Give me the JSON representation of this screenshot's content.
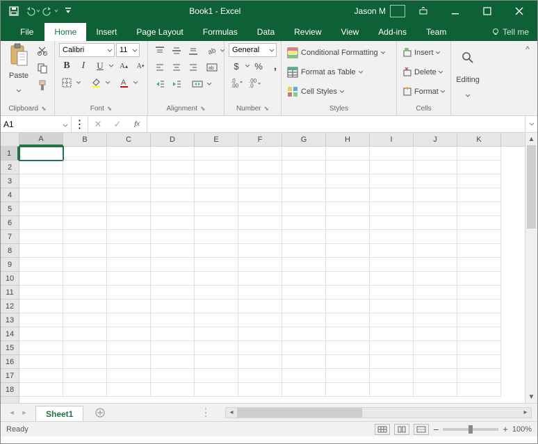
{
  "title": "Book1 - Excel",
  "user": "Jason M",
  "qat": {
    "save": "save-icon",
    "undo": "undo-icon",
    "redo": "redo-icon"
  },
  "tabs": {
    "file": "File",
    "home": "Home",
    "insert": "Insert",
    "pagelayout": "Page Layout",
    "formulas": "Formulas",
    "data": "Data",
    "review": "Review",
    "view": "View",
    "addins": "Add-ins",
    "team": "Team"
  },
  "tellme": "Tell me",
  "ribbon": {
    "clipboard": {
      "label": "Clipboard",
      "paste": "Paste"
    },
    "font": {
      "label": "Font",
      "name": "Calibri",
      "size": "11",
      "bold": "B",
      "italic": "I",
      "underline": "U"
    },
    "alignment": {
      "label": "Alignment"
    },
    "number": {
      "label": "Number",
      "format": "General"
    },
    "styles": {
      "label": "Styles",
      "conditional": "Conditional Formatting",
      "table": "Format as Table",
      "cellstyles": "Cell Styles"
    },
    "cells": {
      "label": "Cells",
      "insert": "Insert",
      "delete": "Delete",
      "format": "Format"
    },
    "editing": {
      "label": "Editing"
    }
  },
  "namebox": "A1",
  "formula": "",
  "columns": [
    "A",
    "B",
    "C",
    "D",
    "E",
    "F",
    "G",
    "H",
    "I",
    "J",
    "K"
  ],
  "rows": [
    "1",
    "2",
    "3",
    "4",
    "5",
    "6",
    "7",
    "8",
    "9",
    "10",
    "11",
    "12",
    "13",
    "14",
    "15",
    "16",
    "17",
    "18"
  ],
  "active_cell": "A1",
  "sheets": {
    "sheet1": "Sheet1"
  },
  "status": {
    "ready": "Ready",
    "zoom": "100%"
  }
}
